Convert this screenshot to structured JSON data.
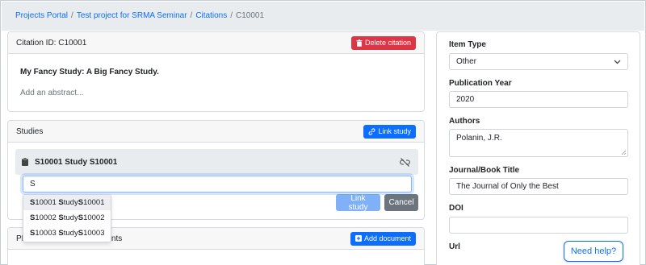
{
  "breadcrumb": {
    "items": [
      "Projects Portal",
      "Test project for SRMA Seminar",
      "Citations"
    ],
    "current": "C10001",
    "separator": "/"
  },
  "citation": {
    "id_label": "Citation ID: C10001",
    "delete_label": "Delete citation",
    "title": "My Fancy Study: A Big Fancy Study.",
    "abstract_placeholder": "Add an abstract..."
  },
  "studies": {
    "header": "Studies",
    "link_study_label": "Link study",
    "linked_study": "S10001 Study S10001",
    "search_value": "S",
    "suggestions": [
      {
        "id": "S10001",
        "text": " Study ",
        "match": "S",
        "rest1": "10001",
        "rest2": "tudy ",
        "rest3": "10001"
      },
      {
        "id": "S10002",
        "text": " Study ",
        "match": "S",
        "rest1": "10002",
        "rest2": "tudy ",
        "rest3": "10002"
      },
      {
        "id": "S10003",
        "text": " Study ",
        "match": "S",
        "rest1": "10003",
        "rest2": "tudy ",
        "rest3": "10003"
      }
    ],
    "link_study_button": "Link study",
    "cancel_button": "Cancel"
  },
  "documents": {
    "header_prefix": "PD",
    "header_suffix": "nts",
    "add_document_label": "Add document"
  },
  "details": {
    "item_type_label": "Item Type",
    "item_type_value": "Other",
    "pub_year_label": "Publication Year",
    "pub_year_value": "2020",
    "authors_label": "Authors",
    "authors_value": "Polanin, J.R.",
    "journal_label": "Journal/Book Title",
    "journal_value": "The Journal of Only the Best",
    "doi_label": "DOI",
    "doi_value": "",
    "url_label": "Url"
  },
  "help": {
    "label": "Need help?"
  },
  "colors": {
    "primary": "#0d6efd",
    "danger": "#dc3545",
    "secondary": "#6c757d"
  }
}
